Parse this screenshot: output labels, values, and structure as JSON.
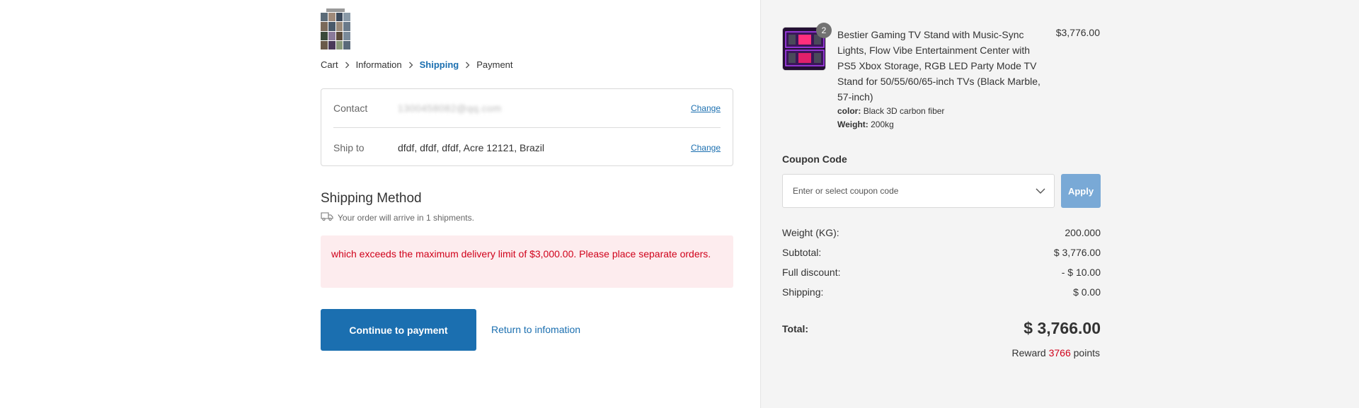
{
  "breadcrumb": {
    "items": [
      "Cart",
      "Information",
      "Shipping",
      "Payment"
    ],
    "active_index": 2
  },
  "info": {
    "contact_label": "Contact",
    "contact_value": "1300458082@qq.com",
    "ship_label": "Ship to",
    "ship_value": "dfdf, dfdf, dfdf, Acre 12121, Brazil",
    "change_label": "Change"
  },
  "shipping": {
    "title": "Shipping Method",
    "note": "Your order will arrive in 1 shipments.",
    "alert": "which exceeds the maximum delivery limit of $3,000.00. Please place separate orders."
  },
  "actions": {
    "continue_label": "Continue to payment",
    "return_label": "Return to infomation"
  },
  "product": {
    "quantity": "2",
    "name": "Bestier Gaming TV Stand with Music-Sync Lights, Flow Vibe Entertainment Center with PS5 Xbox Storage, RGB LED Party Mode TV Stand for 50/55/60/65-inch TVs (Black Marble, 57-inch)",
    "color_label": "color:",
    "color_value": "Black 3D carbon fiber",
    "weight_label": "Weight:",
    "weight_value": "200kg",
    "price": "$3,776.00"
  },
  "coupon": {
    "title": "Coupon Code",
    "placeholder": "Enter or select coupon code",
    "apply_label": "Apply"
  },
  "summary": {
    "rows": [
      {
        "label": "Weight (KG):",
        "value": "200.000"
      },
      {
        "label": "Subtotal:",
        "value": "$ 3,776.00"
      },
      {
        "label": "Full discount:",
        "value": "- $ 10.00"
      },
      {
        "label": "Shipping:",
        "value": "$ 0.00"
      }
    ],
    "total_label": "Total:",
    "total_value": "$ 3,766.00",
    "reward_prefix": "Reward",
    "reward_points": "3766",
    "reward_suffix": "points"
  },
  "colors": {
    "accent": "#1b6fb0",
    "error": "#d0021b",
    "apply_disabled": "#79a9d6",
    "sidebar_bg": "#f4f4f4"
  },
  "icons": [
    "chevron-right-icon",
    "truck-icon",
    "chevron-down-icon"
  ]
}
